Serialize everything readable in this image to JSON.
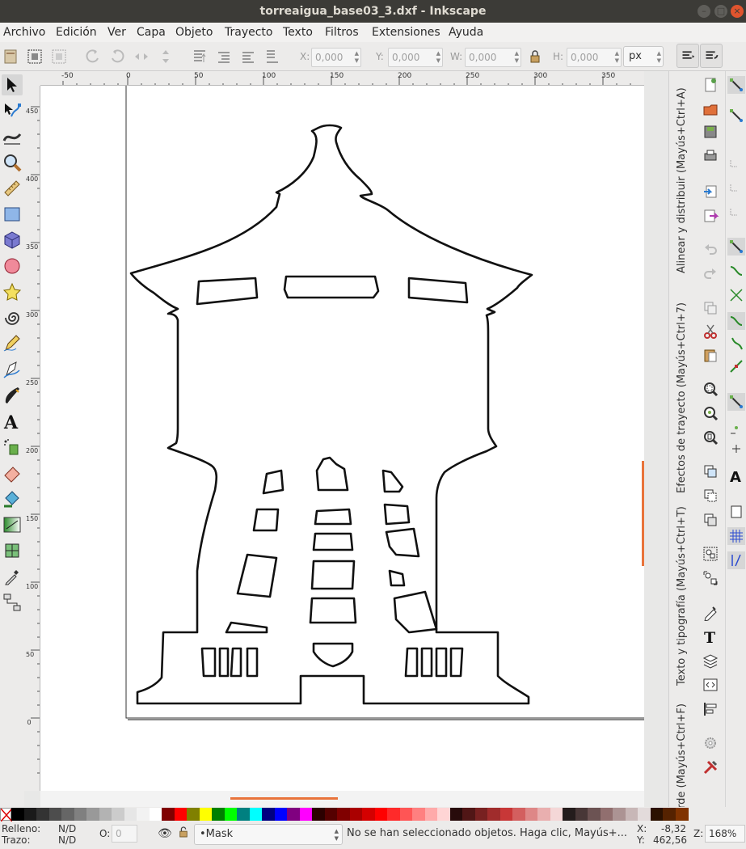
{
  "window": {
    "title": "torreaigua_base03_3.dxf - Inkscape"
  },
  "menu": [
    "Archivo",
    "Edición",
    "Ver",
    "Capa",
    "Objeto",
    "Trayecto",
    "Texto",
    "Filtros",
    "Extensiones",
    "Ayuda"
  ],
  "toolbar": {
    "x_label": "X:",
    "x_value": "0,000",
    "y_label": "Y:",
    "y_value": "0,000",
    "w_label": "W:",
    "w_value": "0,000",
    "h_label": "H:",
    "h_value": "0,000",
    "unit": "px"
  },
  "ruler": {
    "top_labels": [
      "-50",
      "0",
      "50",
      "100",
      "150",
      "200",
      "250",
      "300",
      "350"
    ],
    "left_labels": [
      "450",
      "400",
      "350",
      "300",
      "250",
      "200",
      "150",
      "100",
      "50",
      "0"
    ]
  },
  "dock": {
    "tabs": [
      "Alinear y distribuir (Mayús+Ctrl+A)",
      "Efectos de trayecto (Mayús+Ctrl+7)",
      "Texto y tipografía (Mayús+Ctrl+T)",
      "Relleno y borde (Mayús+Ctrl+F)"
    ]
  },
  "palette": {
    "colors": [
      "#000000",
      "#1a1a1a",
      "#333333",
      "#4d4d4d",
      "#666666",
      "#808080",
      "#999999",
      "#b3b3b3",
      "#cccccc",
      "#e6e6e6",
      "#f2f2f2",
      "#ffffff",
      "#800000",
      "#ff0000",
      "#808000",
      "#ffff00",
      "#008000",
      "#00ff00",
      "#008080",
      "#00ffff",
      "#000080",
      "#0000ff",
      "#800080",
      "#ff00ff",
      "#2b0000",
      "#550000",
      "#800000",
      "#aa0000",
      "#d40000",
      "#ff0000",
      "#ff2a2a",
      "#ff5555",
      "#ff8080",
      "#ffaaaa",
      "#ffd5d5",
      "#280b0b",
      "#501616",
      "#782121",
      "#a02c2c",
      "#c83737",
      "#d35f5f",
      "#de8787",
      "#e9afaf",
      "#f4d7d7",
      "#241c1c",
      "#483737",
      "#6c5353",
      "#916f6f",
      "#ac9393",
      "#c8b7b7",
      "#e3dbdb",
      "#2b1100",
      "#552200",
      "#803300"
    ]
  },
  "status": {
    "fill_label": "Relleno:",
    "fill_value": "N/D",
    "stroke_label": "Trazo:",
    "stroke_value": "N/D",
    "opacity_label": "O:",
    "opacity_value": "0",
    "layer": "•Mask",
    "message": "No se han seleccionado objetos. Haga clic, Mayús+...",
    "x_label": "X:",
    "x_value": "-8,32",
    "y_label": "Y:",
    "y_value": "462,56",
    "zoom_label": "Z:",
    "zoom_value": "168%"
  }
}
